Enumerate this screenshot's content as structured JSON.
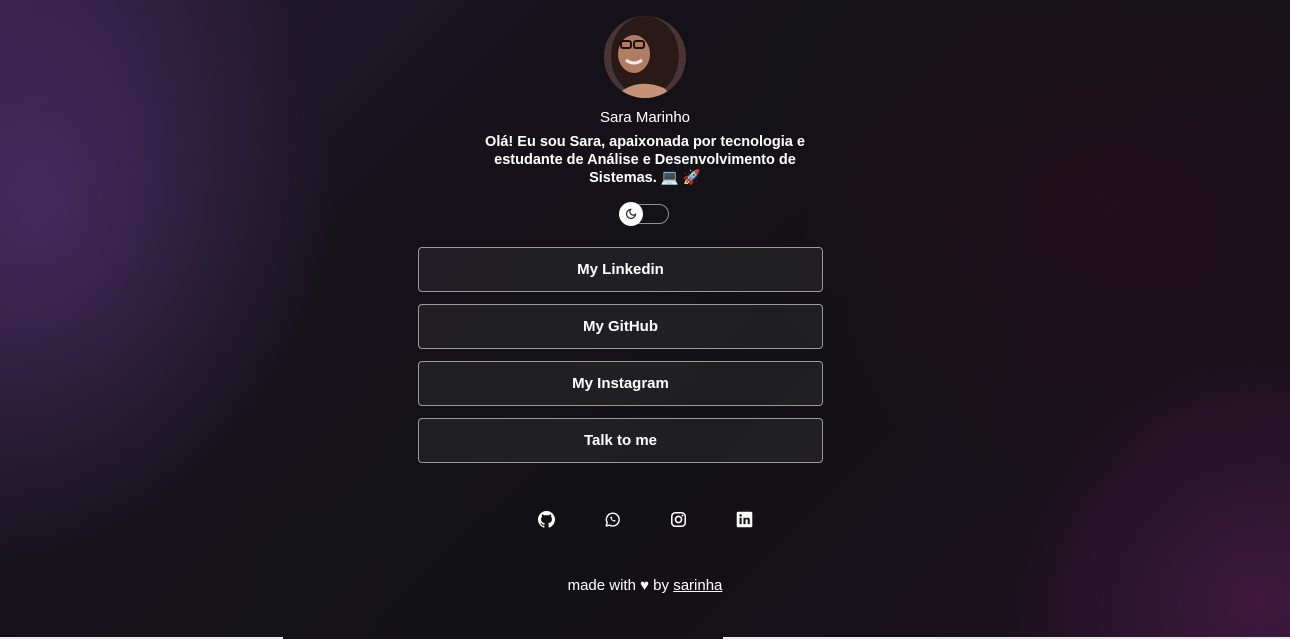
{
  "profile": {
    "name": "Sara Marinho",
    "bio": "Olá! Eu sou Sara, apaixonada por tecnologia e estudante de Análise e Desenvolvimento de Sistemas. 💻 🚀"
  },
  "theme_toggle": {
    "icon": "moon-icon",
    "state": "off"
  },
  "links": [
    {
      "label": "My Linkedin"
    },
    {
      "label": "My GitHub"
    },
    {
      "label": "My Instagram"
    },
    {
      "label": "Talk to me"
    }
  ],
  "socials": [
    {
      "icon": "github-icon"
    },
    {
      "icon": "whatsapp-icon"
    },
    {
      "icon": "instagram-icon"
    },
    {
      "icon": "linkedin-icon"
    }
  ],
  "footer": {
    "prefix": "made with ♥ by",
    "author": "sarinha"
  },
  "colors": {
    "text": "#ffffff",
    "button_border": "#9a9a9f",
    "background_dark": "#141218",
    "background_accent": "#2b1d3c"
  }
}
